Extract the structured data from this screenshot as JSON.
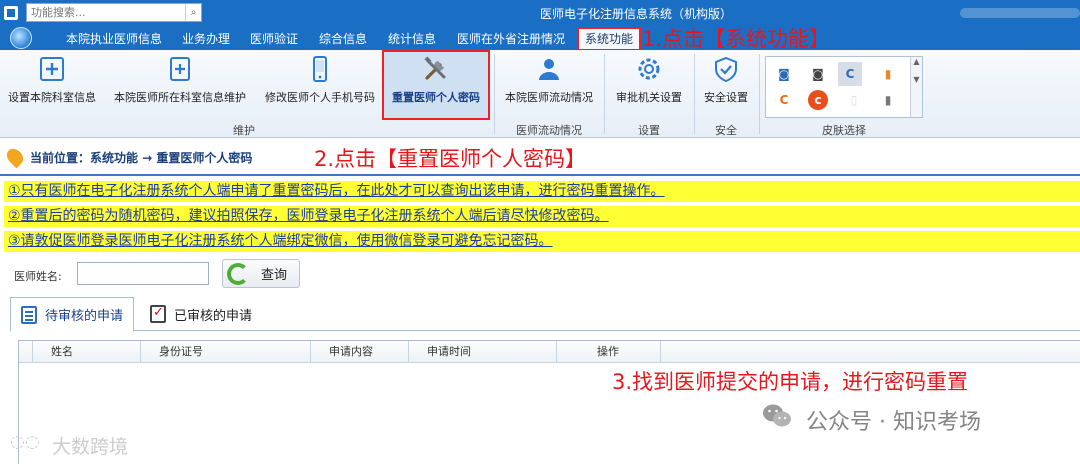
{
  "titlebar": {
    "search_placeholder": "功能搜索...",
    "window_title": "医师电子化注册信息系统（机构版）"
  },
  "menu": {
    "tabs": [
      {
        "label": "本院执业医师信息"
      },
      {
        "label": "业务办理"
      },
      {
        "label": "医师验证"
      },
      {
        "label": "综合信息"
      },
      {
        "label": "统计信息"
      },
      {
        "label": "医师在外省注册情况"
      },
      {
        "label": "系统功能"
      }
    ],
    "active_tab": "系统功能"
  },
  "annotations": {
    "step1": "1.点击【系统功能】",
    "step2": "2.点击【重置医师个人密码】",
    "step3": "3.找到医师提交的申请，进行密码重置"
  },
  "ribbon": {
    "buttons": [
      {
        "label": "设置本院科室信息",
        "icon": "add-box-icon"
      },
      {
        "label": "本院医师所在科室信息维护",
        "icon": "doc-plus-icon"
      },
      {
        "label": "修改医师个人手机号码",
        "icon": "phone-icon"
      },
      {
        "label": "重置医师个人密码",
        "icon": "tools-icon"
      },
      {
        "label": "本院医师流动情况",
        "icon": "user-icon"
      },
      {
        "label": "审批机关设置",
        "icon": "gear-icon"
      },
      {
        "label": "安全设置",
        "icon": "shield-icon"
      }
    ],
    "groups": [
      {
        "label": "维护"
      },
      {
        "label": "医师流动情况"
      },
      {
        "label": "设置"
      },
      {
        "label": "安全"
      },
      {
        "label": "皮肤选择"
      }
    ],
    "colors": {
      "accent": "#1a6fc4",
      "highlight_border": "#e22222"
    }
  },
  "breadcrumb": {
    "text": "当前位置：系统功能 → 重置医师个人密码"
  },
  "notices": [
    "①只有医师在电子化注册系统个人端申请了重置密码后，在此处才可以查询出该申请，进行密码重置操作。",
    "②重置后的密码为随机密码，建议拍照保存，医师登录电子化注册系统个人端后请尽快修改密码。",
    "③请敦促医师登录医师电子化注册系统个人端绑定微信，使用微信登录可避免忘记密码。"
  ],
  "search": {
    "doctor_name_label": "医师姓名:",
    "doctor_name_value": "",
    "query_label": "查询"
  },
  "tabs": [
    {
      "label": "待审核的申请"
    },
    {
      "label": "已审核的申请"
    }
  ],
  "grid": {
    "columns": [
      "姓名",
      "身份证号",
      "申请内容",
      "申请时间",
      "操作"
    ],
    "rows": []
  },
  "watermarks": {
    "left": "大数跨境",
    "right": "公众号 · 知识考场"
  }
}
